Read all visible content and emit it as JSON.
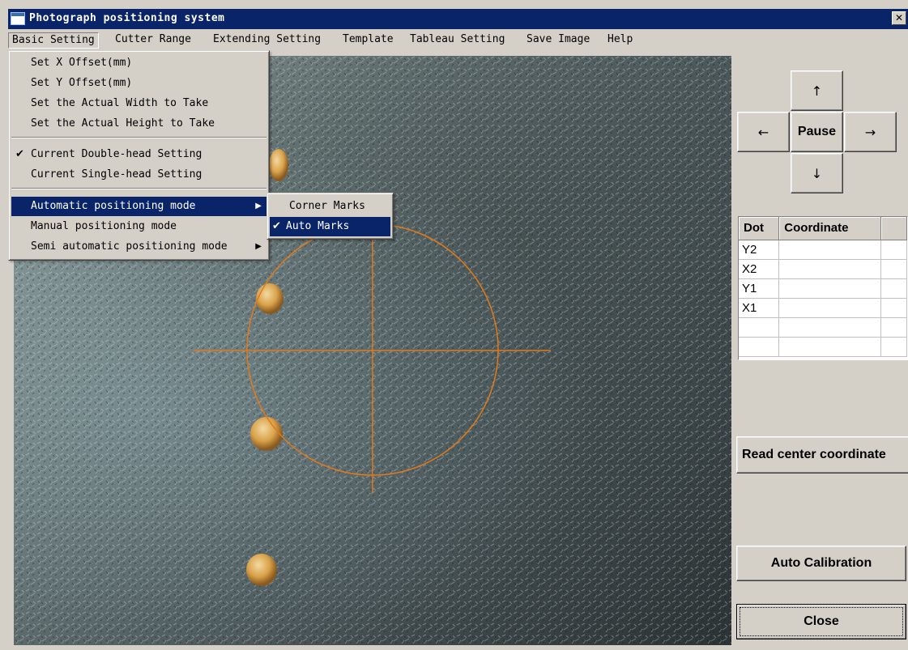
{
  "window": {
    "title": "Photograph positioning system",
    "close_glyph": "✕"
  },
  "menubar": {
    "items": [
      "Basic Setting",
      "Cutter Range",
      "Extending Setting",
      "Template",
      "Tableau Setting",
      "Save Image",
      "Help"
    ],
    "active": "Basic Setting"
  },
  "basic_setting_menu": {
    "items": [
      {
        "label": "Set X Offset(mm)",
        "checked": false,
        "submenu": false
      },
      {
        "label": "Set Y Offset(mm)",
        "checked": false,
        "submenu": false
      },
      {
        "label": "Set the Actual Width to Take",
        "checked": false,
        "submenu": false
      },
      {
        "label": "Set the Actual Height to Take",
        "checked": false,
        "submenu": false
      },
      {
        "label": "Current Double-head Setting",
        "checked": true,
        "submenu": false
      },
      {
        "label": "Current Single-head Setting",
        "checked": false,
        "submenu": false
      },
      {
        "label": "Automatic positioning mode",
        "checked": false,
        "submenu": true,
        "highlighted": true
      },
      {
        "label": "Manual positioning mode",
        "checked": false,
        "submenu": false
      },
      {
        "label": "Semi automatic positioning mode",
        "checked": false,
        "submenu": true
      }
    ],
    "check_glyph": "✔",
    "submenu_glyph": "▶"
  },
  "auto_positioning_submenu": {
    "items": [
      {
        "label": "Corner Marks",
        "checked": false
      },
      {
        "label": "Auto Marks",
        "checked": true,
        "highlighted": true
      }
    ]
  },
  "jog_pad": {
    "up": "↑",
    "down": "↓",
    "left": "←",
    "right": "→",
    "pause": "Pause"
  },
  "dot_table": {
    "columns": [
      "Dot",
      "Coordinate",
      ""
    ],
    "rows": [
      {
        "dot": "Y2",
        "coordinate": ""
      },
      {
        "dot": "X2",
        "coordinate": ""
      },
      {
        "dot": "Y1",
        "coordinate": ""
      },
      {
        "dot": "X1",
        "coordinate": ""
      },
      {
        "dot": "",
        "coordinate": ""
      },
      {
        "dot": "",
        "coordinate": ""
      }
    ]
  },
  "actions": {
    "read_center": "Read center coordinate",
    "auto_calibration": "Auto Calibration",
    "close": "Close"
  },
  "colors": {
    "titlebar": "#0a246a",
    "menu_highlight": "#0a246a",
    "crosshair": "#e07a1a",
    "marker": "#d9a24a",
    "face": "#d4d0c8"
  }
}
